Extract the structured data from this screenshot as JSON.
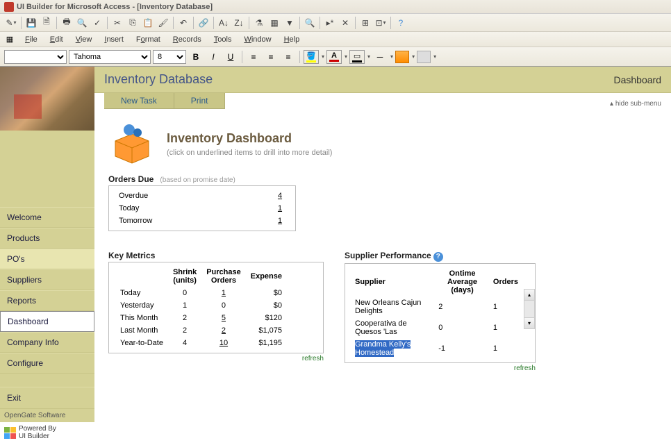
{
  "window": {
    "title": "UI Builder for Microsoft Access - [Inventory Database]"
  },
  "menubar": {
    "items": [
      "File",
      "Edit",
      "View",
      "Insert",
      "Format",
      "Records",
      "Tools",
      "Window",
      "Help"
    ]
  },
  "format_toolbar": {
    "font": "Tahoma",
    "size": "8"
  },
  "sidebar": {
    "nav": [
      "Welcome",
      "Products",
      "PO's",
      "Suppliers",
      "Reports",
      "Dashboard",
      "Company Info",
      "Configure"
    ],
    "exit": "Exit",
    "credit": "OpenGate Software",
    "powered": "Powered By\nUI Builder"
  },
  "content": {
    "title": "Inventory Database",
    "page": "Dashboard",
    "actions": {
      "new_task": "New Task",
      "print": "Print"
    },
    "hide_submenu": "hide sub-menu"
  },
  "dashboard": {
    "title": "Inventory Dashboard",
    "subtitle": "(click on underlined items to drill into more detail)",
    "orders_due": {
      "title": "Orders Due",
      "subtitle": "(based on promise date)",
      "rows": [
        {
          "label": "Overdue",
          "val": "4"
        },
        {
          "label": "Today",
          "val": "1"
        },
        {
          "label": "Tomorrow",
          "val": "1"
        }
      ]
    },
    "key_metrics": {
      "title": "Key Metrics",
      "headers": [
        "",
        "Shrink (units)",
        "Purchase Orders",
        "Expense"
      ],
      "rows": [
        {
          "label": "Today",
          "shrink": "0",
          "po": "1",
          "expense": "$0"
        },
        {
          "label": "Yesterday",
          "shrink": "1",
          "po": "0",
          "expense": "$0"
        },
        {
          "label": "This Month",
          "shrink": "2",
          "po": "5",
          "expense": "$120"
        },
        {
          "label": "Last Month",
          "shrink": "2",
          "po": "2",
          "expense": "$1,075"
        },
        {
          "label": "Year-to-Date",
          "shrink": "4",
          "po": "10",
          "expense": "$1,195"
        }
      ],
      "refresh": "refresh"
    },
    "supplier_perf": {
      "title": "Supplier Performance",
      "headers": [
        "Supplier",
        "Ontime Average (days)",
        "Orders"
      ],
      "rows": [
        {
          "name": "New Orleans Cajun Delights",
          "ontime": "2",
          "orders": "1"
        },
        {
          "name": "Cooperativa de Quesos 'Las",
          "ontime": "0",
          "orders": "1"
        },
        {
          "name": "Grandma Kelly's Homestead",
          "ontime": "-1",
          "orders": "1"
        }
      ],
      "refresh": "refresh"
    }
  }
}
